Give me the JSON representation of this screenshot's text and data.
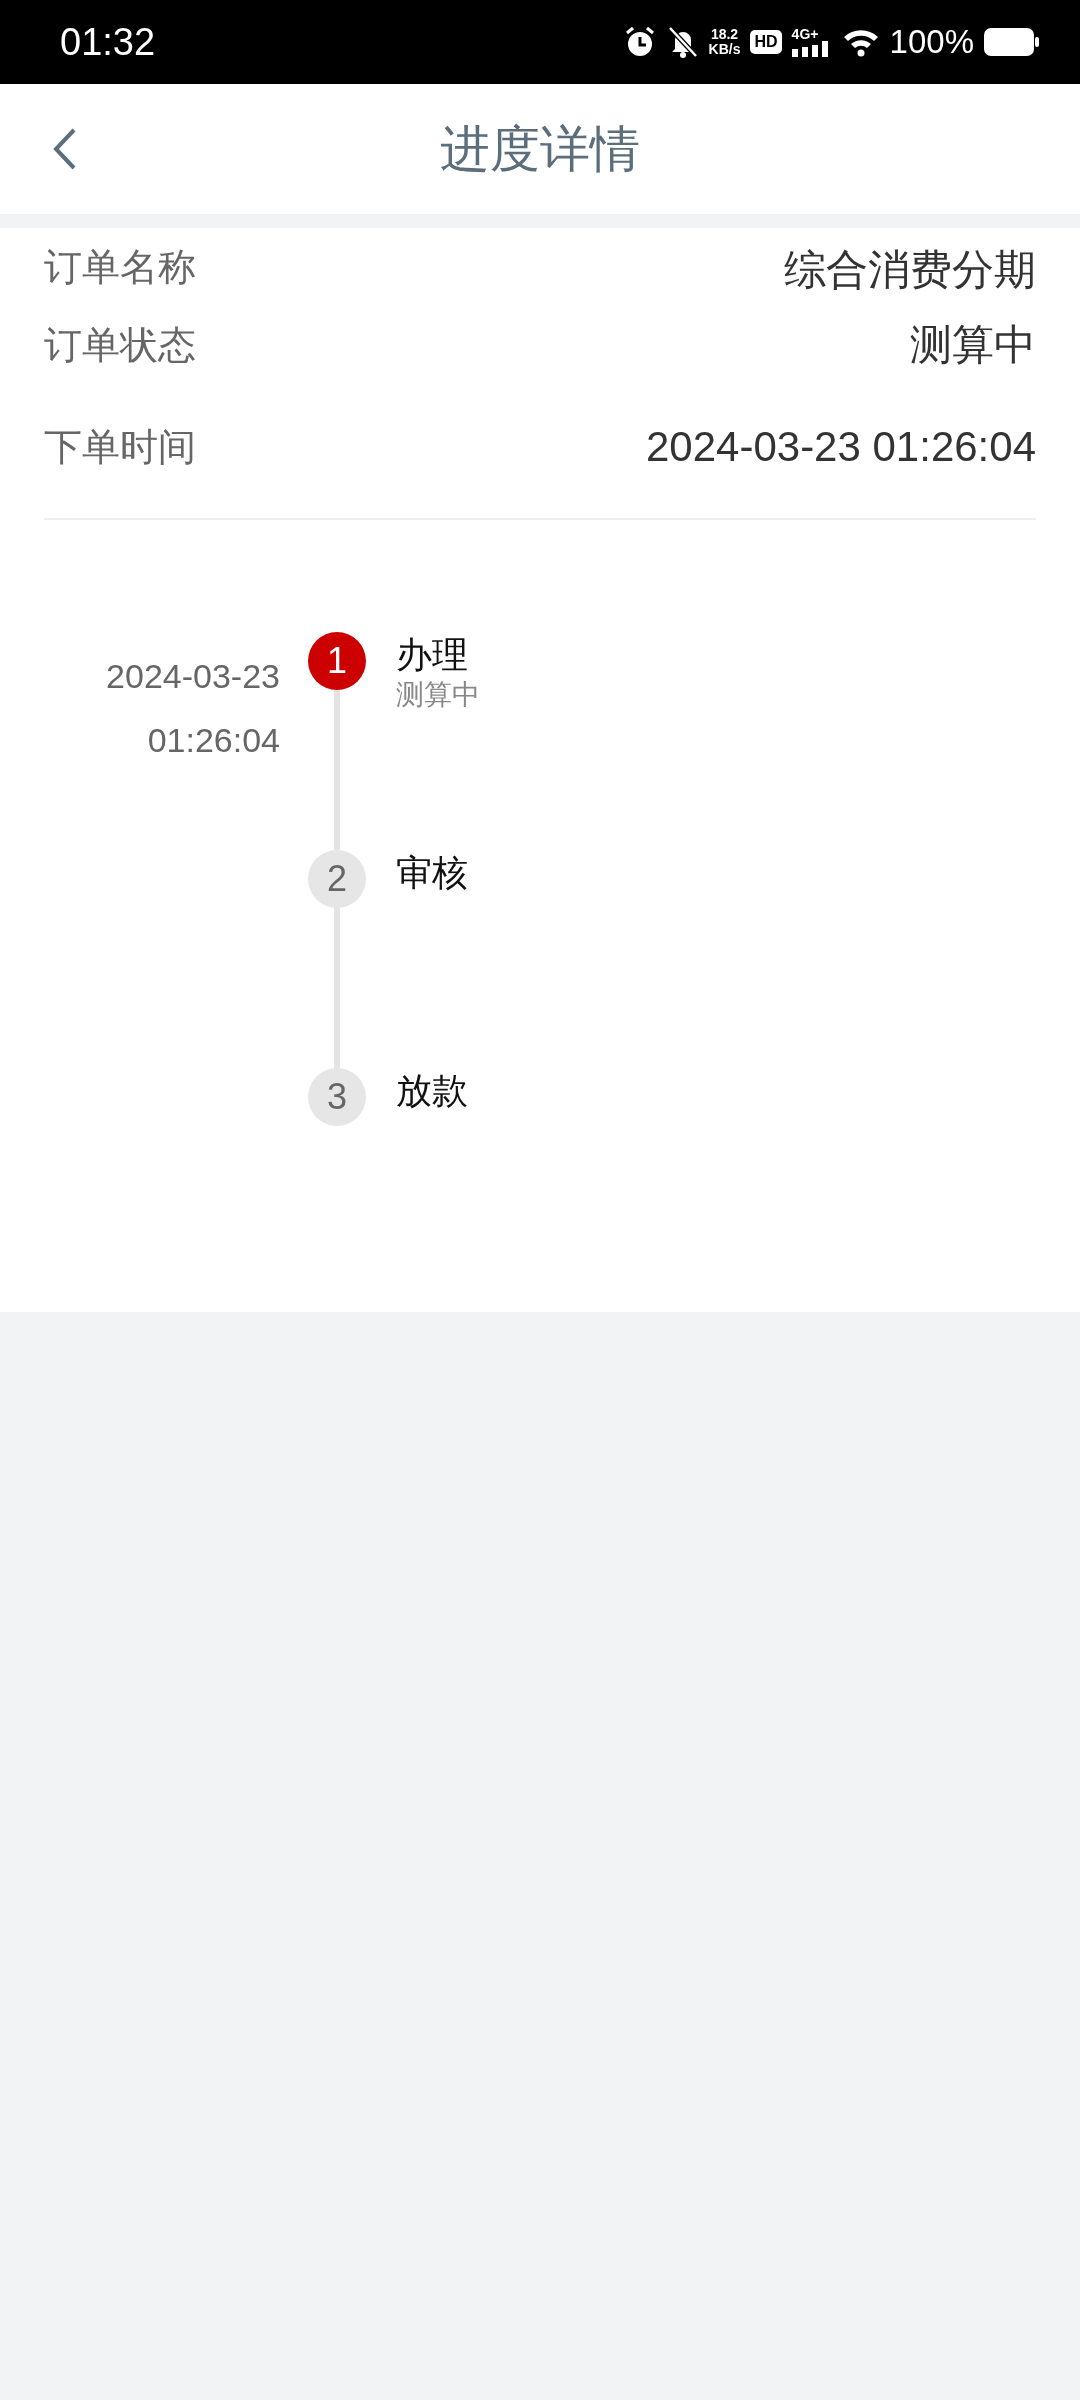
{
  "status_bar": {
    "time": "01:32",
    "net_speed": "18.2",
    "net_unit": "KB/s",
    "hd": "HD",
    "network": "4G+",
    "battery": "100%"
  },
  "header": {
    "title": "进度详情"
  },
  "info": [
    {
      "label": "订单名称",
      "value": "综合消费分期"
    },
    {
      "label": "订单状态",
      "value": "测算中"
    },
    {
      "label": "下单时间",
      "value": "2024-03-23 01:26:04"
    }
  ],
  "steps": [
    {
      "number": "1",
      "title": "办理",
      "subtitle": "测算中",
      "date": "2024-03-23",
      "time": "01:26:04",
      "active": true
    },
    {
      "number": "2",
      "title": "审核",
      "active": false
    },
    {
      "number": "3",
      "title": "放款",
      "active": false
    }
  ]
}
